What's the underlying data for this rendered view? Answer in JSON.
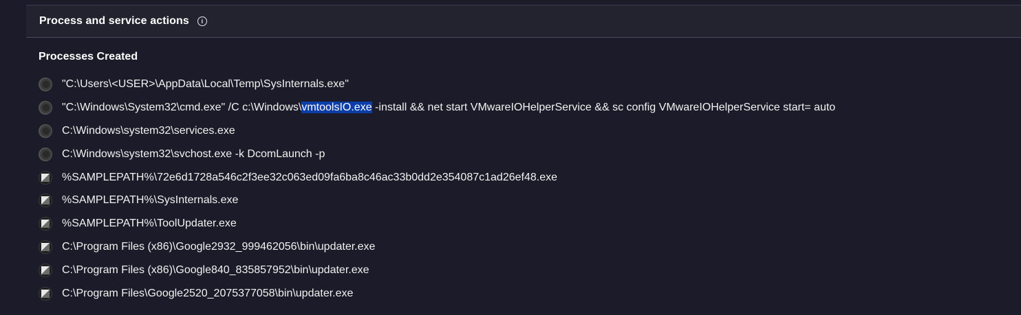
{
  "section": {
    "title": "Process and service actions",
    "info_icon": "info-circle-icon"
  },
  "processes": {
    "title": "Processes Created",
    "items": [
      {
        "icon": "commandline-icon",
        "text": "\"C:\\Users\\<USER>\\AppData\\Local\\Temp\\SysInternals.exe\""
      },
      {
        "icon": "commandline-icon",
        "pre": "\"C:\\Windows\\System32\\cmd.exe\" /C c:\\Windows\\",
        "highlight": "vmtoolsIO.exe",
        "post": " -install && net start VMwareIOHelperService && sc config VMwareIOHelperService start= auto"
      },
      {
        "icon": "commandline-icon",
        "text": "C:\\Windows\\system32\\services.exe"
      },
      {
        "icon": "commandline-icon",
        "text": "C:\\Windows\\system32\\svchost.exe -k DcomLaunch -p"
      },
      {
        "icon": "file-icon",
        "text": "%SAMPLEPATH%\\72e6d1728a546c2f3ee32c063ed09fa6ba8c46ac33b0dd2e354087c1ad26ef48.exe"
      },
      {
        "icon": "file-icon",
        "text": "%SAMPLEPATH%\\SysInternals.exe"
      },
      {
        "icon": "file-icon",
        "text": "%SAMPLEPATH%\\ToolUpdater.exe"
      },
      {
        "icon": "file-icon",
        "text": "C:\\Program Files (x86)\\Google2932_999462056\\bin\\updater.exe"
      },
      {
        "icon": "file-icon",
        "text": "C:\\Program Files (x86)\\Google840_835857952\\bin\\updater.exe"
      },
      {
        "icon": "file-icon",
        "text": "C:\\Program Files\\Google2520_2075377058\\bin\\updater.exe"
      }
    ]
  }
}
